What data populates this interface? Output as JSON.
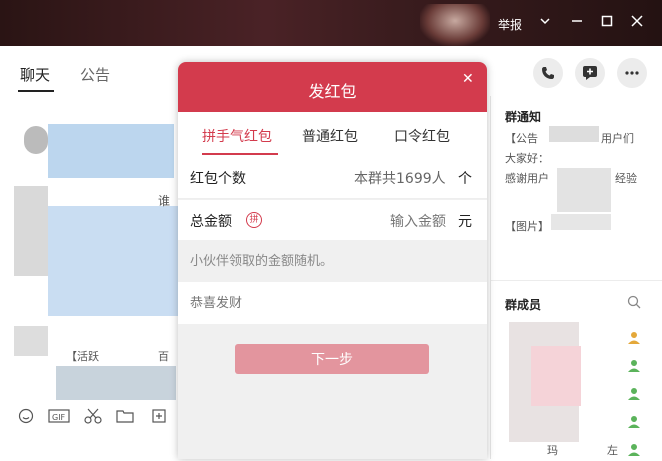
{
  "titlebar": {
    "report_label": "举报"
  },
  "tabs": [
    {
      "label": "聊天"
    },
    {
      "label": "公告"
    }
  ],
  "dialog": {
    "title": "发红包",
    "tabs": [
      {
        "label": "拼手气红包"
      },
      {
        "label": "普通红包"
      },
      {
        "label": "口令红包"
      }
    ],
    "count_label": "红包个数",
    "count_hint": "本群共1699人",
    "count_unit": "个",
    "amount_label": "总金额",
    "amount_badge": "拼",
    "amount_placeholder": "输入金额",
    "amount_unit": "元",
    "random_hint": "小伙伴领取的金额随机。",
    "wish_placeholder": "恭喜发财",
    "next_label": "下一步"
  },
  "side": {
    "notice_title": "群通知",
    "notice_line1_prefix": "【公告",
    "notice_line1_suffix": "用户们",
    "notice_line2": "大家好：",
    "notice_line3_prefix": "感谢用户",
    "notice_line3_suffix": "经验",
    "notice_line4": "【图片】",
    "members_title": "群成员",
    "member_partial_1": "玛",
    "member_partial_2": "左"
  },
  "chat": {
    "partial_text_1": "谁",
    "partial_text_2": "【活跃",
    "partial_text_3": "百跳"
  },
  "colors": {
    "accent": "#d33b4d",
    "next_button": "#e3959e"
  }
}
